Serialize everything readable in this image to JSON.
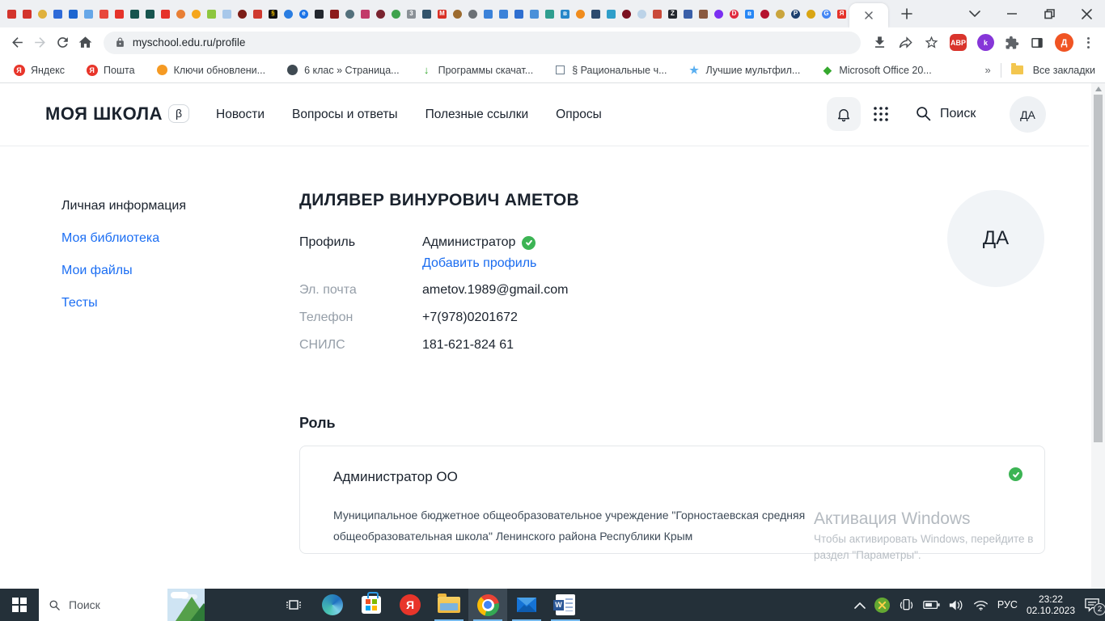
{
  "browser": {
    "url": "myschool.edu.ru/profile",
    "pinned_tabs": [
      {
        "c": "#d3342c",
        "s": "s"
      },
      {
        "c": "#d3342c",
        "s": "s"
      },
      {
        "c": "#e0b13c",
        "s": "c"
      },
      {
        "c": "#2f6bd8",
        "s": "s"
      },
      {
        "c": "#1e66d0",
        "s": "s"
      },
      {
        "c": "#66a7e8",
        "s": "s"
      },
      {
        "c": "#e8483c",
        "s": "s"
      },
      {
        "c": "#e5332a",
        "s": "s"
      },
      {
        "c": "#16544e",
        "s": "s"
      },
      {
        "c": "#16544e",
        "s": "s"
      },
      {
        "c": "#e5332a",
        "s": "s"
      },
      {
        "c": "#e87f35",
        "s": "c"
      },
      {
        "c": "#f5a61d",
        "s": "c"
      },
      {
        "c": "#8dc63f",
        "s": "s"
      },
      {
        "c": "#a8c8ea",
        "s": "s"
      },
      {
        "c": "#7c1d17",
        "s": "c"
      },
      {
        "c": "#cf3a30",
        "s": "s"
      },
      {
        "c": "#111111",
        "s": "s",
        "t": "§",
        "tc": "#f2c200"
      },
      {
        "c": "#2a7de1",
        "s": "c"
      },
      {
        "c": "#1a73e8",
        "s": "c",
        "t": "e"
      },
      {
        "c": "#23272e",
        "s": "s"
      },
      {
        "c": "#8c1c1c",
        "s": "s"
      },
      {
        "c": "#53707c",
        "s": "c"
      },
      {
        "c": "#c23a6a",
        "s": "s"
      },
      {
        "c": "#7a2430",
        "s": "c"
      },
      {
        "c": "#3fa34d",
        "s": "c"
      },
      {
        "c": "#8a9096",
        "s": "s",
        "t": "3"
      },
      {
        "c": "#32536b",
        "s": "s"
      },
      {
        "c": "#d93025",
        "s": "s",
        "t": "M"
      },
      {
        "c": "#9c6b2f",
        "s": "c"
      },
      {
        "c": "#6b7075",
        "s": "c"
      },
      {
        "c": "#3b82d9",
        "s": "s"
      },
      {
        "c": "#3b82d9",
        "s": "s"
      },
      {
        "c": "#2f6fd0",
        "s": "s"
      },
      {
        "c": "#4a90d9",
        "s": "s"
      },
      {
        "c": "#2f9e8f",
        "s": "s"
      },
      {
        "c": "#2787c9",
        "s": "s",
        "t": "в"
      },
      {
        "c": "#f08c1d",
        "s": "c"
      },
      {
        "c": "#2c4a6e",
        "s": "s"
      },
      {
        "c": "#2f9ec9",
        "s": "s"
      },
      {
        "c": "#7a1020",
        "s": "c"
      },
      {
        "c": "#bcd3e8",
        "s": "c"
      },
      {
        "c": "#c94a3a",
        "s": "s"
      },
      {
        "c": "#23272e",
        "s": "s",
        "t": "Z"
      },
      {
        "c": "#3a5fa8",
        "s": "s"
      },
      {
        "c": "#8a5a40",
        "s": "s"
      },
      {
        "c": "#7b2ff2",
        "s": "c"
      },
      {
        "c": "#e0293d",
        "s": "c",
        "t": "D"
      },
      {
        "c": "#2787f5",
        "s": "s",
        "t": "в"
      },
      {
        "c": "#b5122f",
        "s": "c"
      },
      {
        "c": "#caa53d",
        "s": "c"
      },
      {
        "c": "#1c3f6e",
        "s": "c",
        "t": "Р"
      },
      {
        "c": "#d9a514",
        "s": "c"
      },
      {
        "c": "#4285f4",
        "s": "c",
        "t": "G"
      },
      {
        "c": "#e5332a",
        "s": "s",
        "t": "Я"
      }
    ],
    "extensions": {
      "adblock_badge": "ABP",
      "k_badge": "k",
      "profile_letter": "Д"
    },
    "bookmarks": [
      {
        "label": "Яндекс",
        "icon": "letter",
        "glyph": "Я",
        "color": "#e8352a"
      },
      {
        "label": "Пошта",
        "icon": "letter",
        "glyph": "Я",
        "color": "#e8352a"
      },
      {
        "label": "Ключи обновлени...",
        "icon": "circle",
        "color": "#f59a23"
      },
      {
        "label": "6 клас » Страница...",
        "icon": "circle",
        "color": "#3f4a52"
      },
      {
        "label": "Программы скачат...",
        "icon": "glyph",
        "glyph": "↓",
        "color": "#35a82e"
      },
      {
        "label": "§ Рациональные ч...",
        "icon": "cube",
        "color": "#6b7c8c"
      },
      {
        "label": "Лучшие мультфил...",
        "icon": "glyph",
        "glyph": "★",
        "color": "#58aef0"
      },
      {
        "label": "Microsoft Office 20...",
        "icon": "glyph",
        "glyph": "◆",
        "color": "#35a82e"
      }
    ],
    "bookmarks_overflow": "»",
    "all_bookmarks_label": "Все закладки"
  },
  "site": {
    "logo": "МОЯ ШКОЛА",
    "beta": "β",
    "nav": [
      "Новости",
      "Вопросы и ответы",
      "Полезные ссылки",
      "Опросы"
    ],
    "search_label": "Поиск",
    "avatar_initials": "ДА",
    "sidebar": [
      {
        "label": "Личная информация",
        "active": true
      },
      {
        "label": "Моя библиотека",
        "active": false
      },
      {
        "label": "Мои файлы",
        "active": false
      },
      {
        "label": "Тесты",
        "active": false
      }
    ],
    "profile": {
      "name": "ДИЛЯВЕР ВИНУРОВИЧ АМЕТОВ",
      "avatar_initials": "ДА",
      "rows": [
        {
          "label": "Профиль",
          "label_dark": true,
          "value": "Администратор",
          "verified": true,
          "extra_link": "Добавить профиль"
        },
        {
          "label": "Эл. почта",
          "value": "ametov.1989@gmail.com"
        },
        {
          "label": "Телефон",
          "value": "+7(978)0201672"
        },
        {
          "label": "СНИЛС",
          "value": "181-621-824 61"
        }
      ]
    },
    "role_section": {
      "heading": "Роль",
      "card": {
        "title": "Администратор ОО",
        "description": "Муниципальное бюджетное общеобразовательное учреждение \"Горностаевская средняя общеобразовательная школа\" Ленинского района Республики Крым",
        "verified": true
      }
    }
  },
  "watermark": {
    "title": "Активация Windows",
    "line1": "Чтобы активировать Windows, перейдите в",
    "line2": "раздел \"Параметры\"."
  },
  "taskbar": {
    "search_placeholder": "Поиск",
    "yandex_letter": "Я",
    "word_letter": "W",
    "tray": {
      "lang": "РУС",
      "time": "23:22",
      "date": "02.10.2023",
      "notification_count": "2"
    }
  },
  "colors": {
    "link_blue": "#1a6cf0",
    "green_check": "#3cb454",
    "taskbar_bg": "#243039",
    "watermark_grey": "#b4bac0"
  }
}
